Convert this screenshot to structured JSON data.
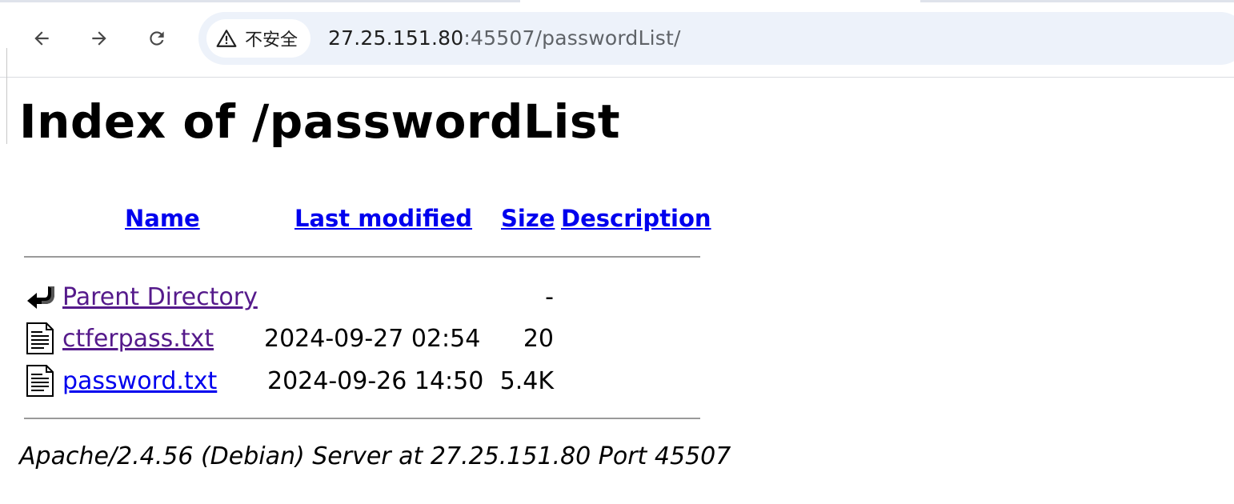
{
  "browser": {
    "security_label": "不安全",
    "url_host": "27.25.151.80",
    "url_rest": ":45507/passwordList/"
  },
  "page": {
    "title": "Index of /passwordList",
    "columns": {
      "name": "Name",
      "last_modified": "Last modified",
      "size": "Size",
      "description": "Description"
    },
    "rows": [
      {
        "name": "Parent Directory",
        "modified": "",
        "size": "-",
        "icon": "back-arrow-icon"
      },
      {
        "name": "ctferpass.txt",
        "modified": "2024-09-27 02:54",
        "size": "20",
        "icon": "text-file-icon"
      },
      {
        "name": "password.txt",
        "modified": "2024-09-26 14:50",
        "size": "5.4K",
        "icon": "text-file-icon"
      }
    ],
    "footer": "Apache/2.4.56 (Debian) Server at 27.25.151.80 Port 45507"
  }
}
